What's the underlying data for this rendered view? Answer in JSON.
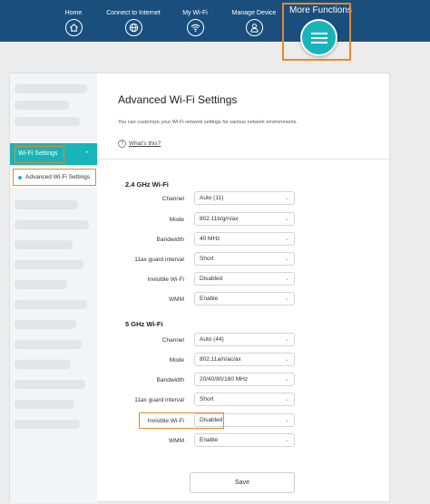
{
  "nav": {
    "items": [
      {
        "label": "Home",
        "icon": "home-icon"
      },
      {
        "label": "Connect to Internet",
        "icon": "globe-icon"
      },
      {
        "label": "My Wi-Fi",
        "icon": "wifi-icon"
      },
      {
        "label": "Manage Device",
        "icon": "user-icon"
      }
    ],
    "more_label": "More Functions",
    "more_icon": "menu-icon"
  },
  "sidebar": {
    "section_label": "Wi-Fi Settings",
    "section_icon": "chevron-up-icon",
    "active_item": "Advanced Wi-Fi Settings"
  },
  "page": {
    "title": "Advanced Wi-Fi Settings",
    "description": "You can customize your Wi-Fi network settings for various network environments.",
    "help_link": "What's this?"
  },
  "band_24": {
    "heading": "2.4 GHz Wi-Fi",
    "rows": [
      {
        "label": "Channel",
        "value": "Auto (11)"
      },
      {
        "label": "Mode",
        "value": "802.11b/g/n/ax"
      },
      {
        "label": "Bandwidth",
        "value": "40 MHz"
      },
      {
        "label": "11ax guard interval",
        "value": "Short"
      },
      {
        "label": "Invisible Wi-Fi",
        "value": "Disabled"
      },
      {
        "label": "WMM",
        "value": "Enable"
      }
    ]
  },
  "band_5": {
    "heading": "5 GHz Wi-Fi",
    "rows": [
      {
        "label": "Channel",
        "value": "Auto (44)"
      },
      {
        "label": "Mode",
        "value": "802.11a/n/ac/ax"
      },
      {
        "label": "Bandwidth",
        "value": "20/40/80/160 MHz"
      },
      {
        "label": "11ax guard interval",
        "value": "Short"
      },
      {
        "label": "Invisible Wi-Fi",
        "value": "Disabled"
      },
      {
        "label": "WMM",
        "value": "Enable"
      }
    ]
  },
  "save_label": "Save",
  "colors": {
    "nav_bg": "#1a4f7d",
    "accent": "#19b4ba",
    "highlight_frame": "#e58a2e"
  }
}
